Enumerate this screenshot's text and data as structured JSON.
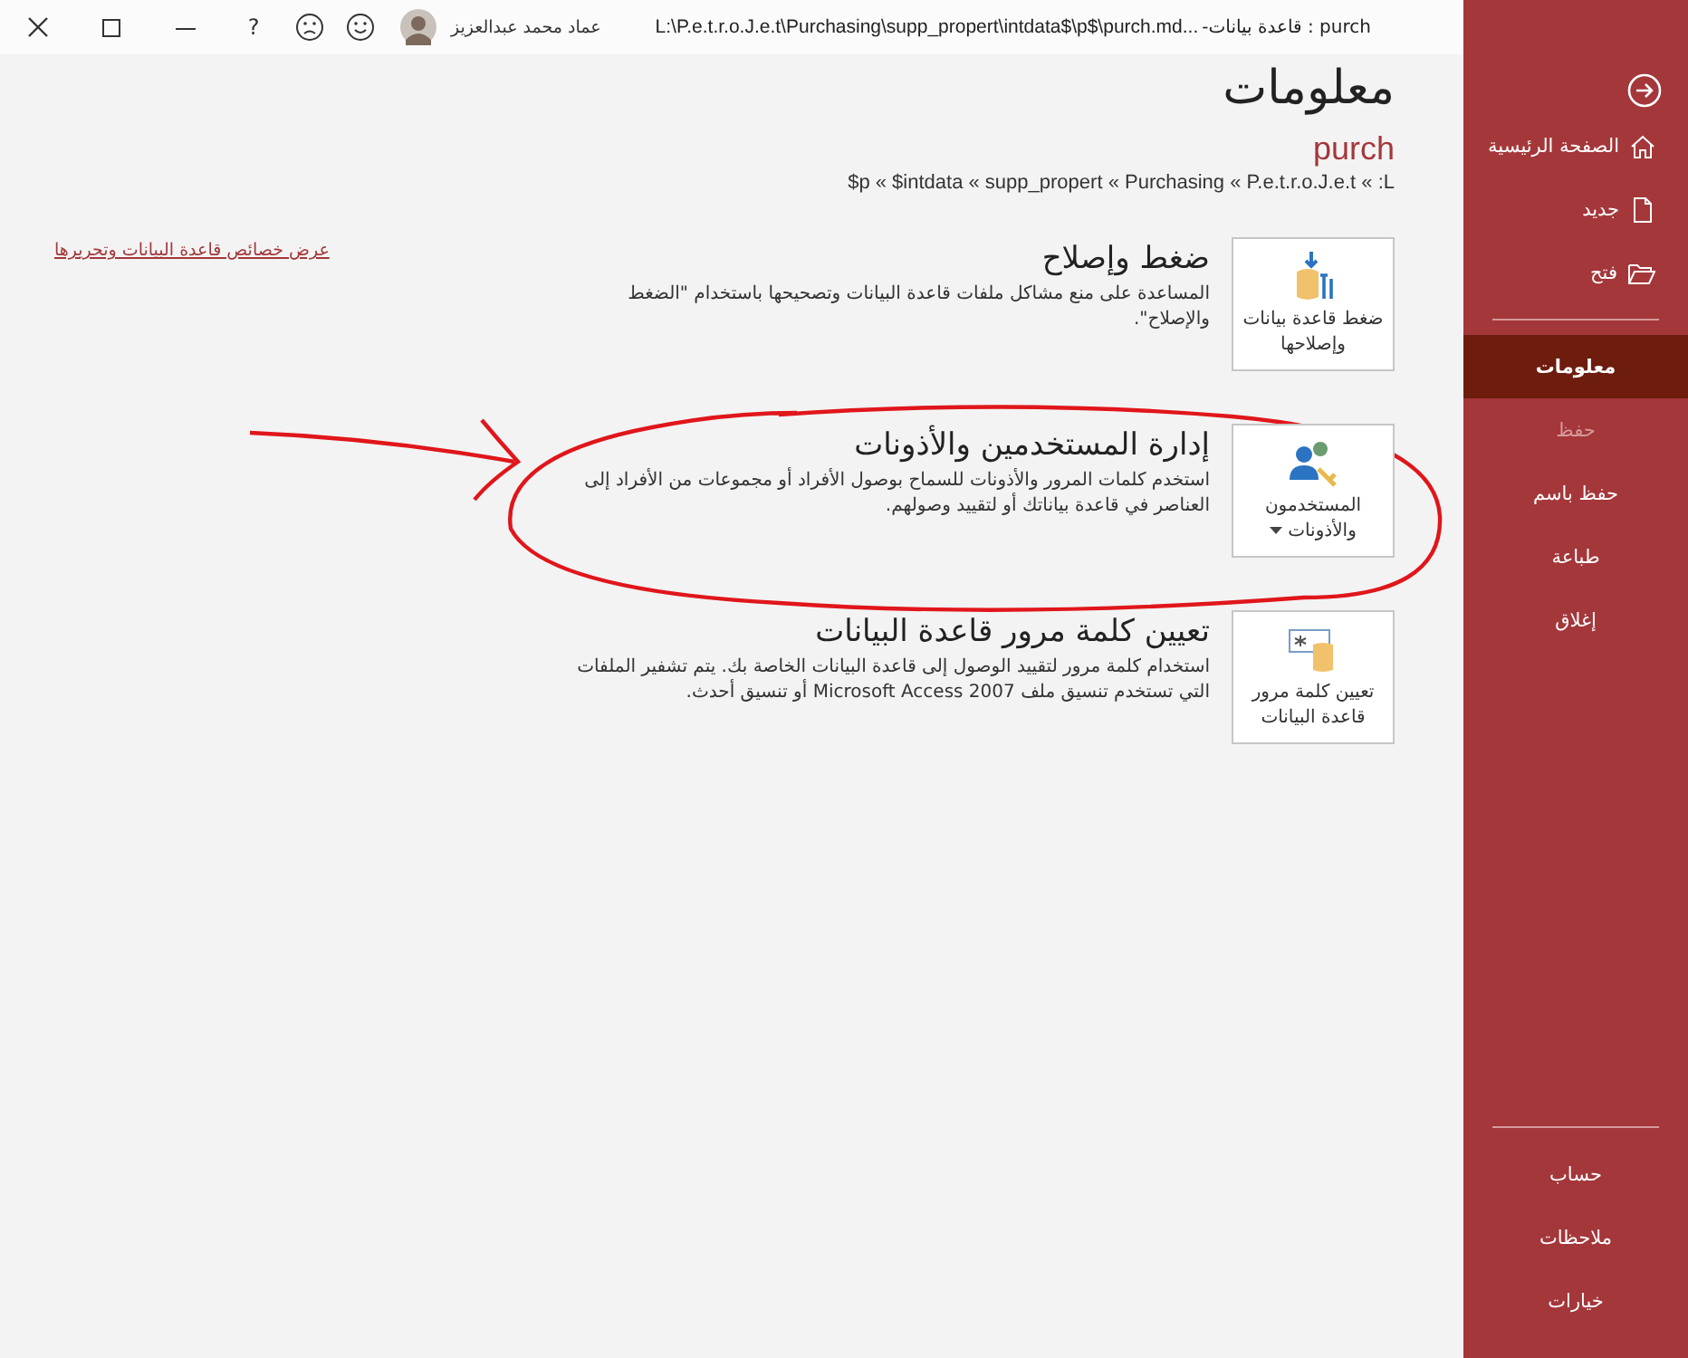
{
  "title_bar": {
    "title_app": "purch : قاعدة بيانات-",
    "title_path": "L:\\P.e.t.r.o.J.e.t\\Purchasing\\supp_propert\\intdata$\\p$\\purch.md...",
    "user": "عماد محمد عبدالعزيز",
    "help": "?"
  },
  "sidebar": {
    "top_items": [
      {
        "label": "الصفحة الرئيسية",
        "kind": "home",
        "selected": false,
        "disabled": false
      },
      {
        "label": "جديد",
        "kind": "new",
        "selected": false,
        "disabled": false
      },
      {
        "label": "فتح",
        "kind": "open",
        "selected": false,
        "disabled": false
      }
    ],
    "main_items": [
      {
        "label": "معلومات",
        "selected": true,
        "disabled": false
      },
      {
        "label": "حفظ",
        "selected": false,
        "disabled": true
      },
      {
        "label": "حفظ باسم",
        "selected": false,
        "disabled": false
      },
      {
        "label": "طباعة",
        "selected": false,
        "disabled": false
      },
      {
        "label": "إغلاق",
        "selected": false,
        "disabled": false
      }
    ],
    "bottom_items": [
      {
        "label": "حساب",
        "selected": false,
        "disabled": false
      },
      {
        "label": "ملاحظات",
        "selected": false,
        "disabled": false
      },
      {
        "label": "خيارات",
        "selected": false,
        "disabled": false
      }
    ]
  },
  "page": {
    "heading": "معلومات",
    "file_name": "purch",
    "path": "$p « $intdata « supp_propert « Purchasing « P.e.t.r.o.J.e.t « :L",
    "properties_link": "عرض خصائص قاعدة البيانات وتحريرها"
  },
  "sections": [
    {
      "kind": "compact",
      "button_label": "ضغط قاعدة بيانات وإصلاحها",
      "dropdown": false,
      "title": "ضغط وإصلاح",
      "description": "المساعدة على منع مشاكل ملفات قاعدة البيانات وتصحيحها باستخدام \"الضغط والإصلاح\"."
    },
    {
      "kind": "users",
      "button_label": "المستخدمون والأذونات",
      "dropdown": true,
      "title": "إدارة المستخدمين والأذونات",
      "description": "استخدم كلمات المرور والأذونات للسماح بوصول الأفراد أو مجموعات من الأفراد إلى العناصر في قاعدة بياناتك أو لتقييد وصولهم."
    },
    {
      "kind": "password",
      "button_label": "تعيين كلمة مرور قاعدة البيانات",
      "dropdown": false,
      "title": "تعيين كلمة مرور قاعدة البيانات",
      "description": "استخدام كلمة مرور لتقييد الوصول إلى قاعدة البيانات الخاصة بك. يتم تشفير الملفات التي تستخدم تنسيق ملف Microsoft Access 2007 أو تنسيق أحدث."
    }
  ]
}
